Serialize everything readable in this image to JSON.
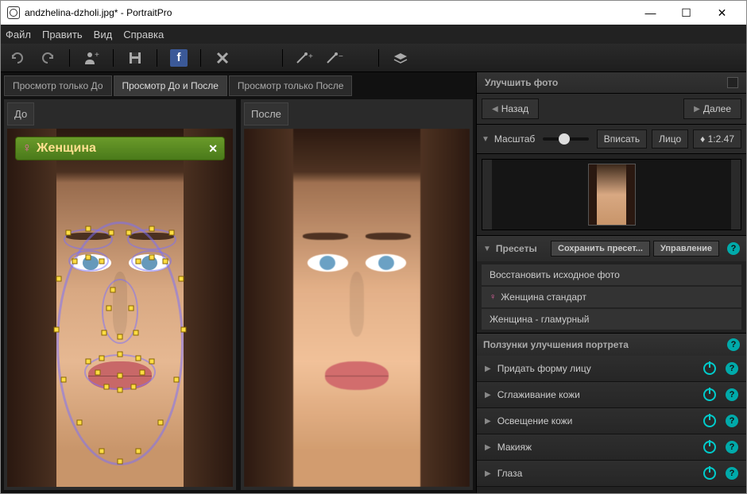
{
  "window": {
    "title": "andzhelina-dzholi.jpg* - PortraitPro"
  },
  "menu": {
    "file": "Файл",
    "edit": "Править",
    "view": "Вид",
    "help": "Справка"
  },
  "tabs": {
    "before_only": "Просмотр только До",
    "before_after": "Просмотр До и После",
    "after_only": "Просмотр только После"
  },
  "views": {
    "before": "До",
    "after": "После"
  },
  "gender_tag": {
    "label": "Женщина"
  },
  "panel": {
    "title": "Улучшить фото",
    "back": "Назад",
    "next": "Далее",
    "zoom_label": "Масштаб",
    "fit": "Вписать",
    "face": "Лицо",
    "ratio": "1:2.47",
    "presets_title": "Пресеты",
    "save_preset": "Сохранить пресет...",
    "manage": "Управление",
    "presets": [
      "Восстановить исходное фото",
      "Женщина стандарт",
      "Женщина - гламурный"
    ],
    "sliders_title": "Ползунки улучшения портрета",
    "sliders": [
      "Придать форму лицу",
      "Сглаживание кожи",
      "Освещение кожи",
      "Макияж",
      "Глаза"
    ]
  }
}
